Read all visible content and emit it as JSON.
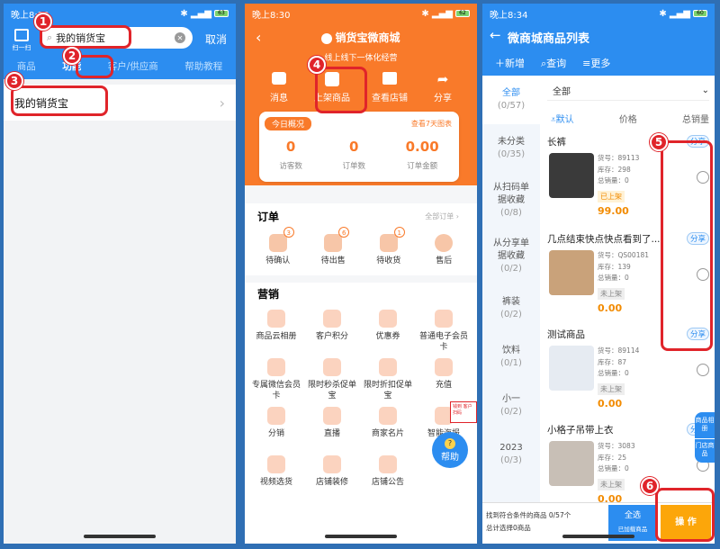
{
  "p1": {
    "status_time": "晚上8:30",
    "scan_label": "扫一扫",
    "search_value": "我的销货宝",
    "cancel": "取消",
    "tabs": [
      "商品",
      "功能",
      "客户/供应商",
      "帮助教程"
    ],
    "result": "我的销货宝",
    "markers": [
      "1",
      "2",
      "3"
    ]
  },
  "p2": {
    "status_time": "晚上8:30",
    "title": "销货宝微商城",
    "subtitle": "线上线下一体化经营",
    "top_actions": [
      "消息",
      "上架商品",
      "查看店铺",
      "分享"
    ],
    "overview_label": "今日概况",
    "overview_link": "查看7天图表",
    "stats": [
      {
        "value": "0",
        "label": "访客数"
      },
      {
        "value": "0",
        "label": "订单数"
      },
      {
        "value": "0.00",
        "label": "订单金额"
      }
    ],
    "orders_title": "订单",
    "orders_link": "全部订单",
    "orders": [
      {
        "label": "待确认",
        "count": "3"
      },
      {
        "label": "待出售",
        "count": "6"
      },
      {
        "label": "待收货",
        "count": "1"
      },
      {
        "label": "售后",
        "count": ""
      }
    ],
    "marketing_title": "营销",
    "marketing": [
      "商品云相册",
      "客户积分",
      "优惠券",
      "普通电子会员卡",
      "专属微信会员卡",
      "限时秒杀促单宝",
      "限时折扣促单宝",
      "充值",
      "分销",
      "直播",
      "商家名片",
      "智能海报",
      "视频选货",
      "店铺装修",
      "店铺公告"
    ],
    "help_button": "帮助",
    "marker": "4",
    "floating_tag": "钱到 客户扫码"
  },
  "p3": {
    "status_time": "晚上8:34",
    "title": "微商城商品列表",
    "actions": [
      "新增",
      "查询",
      "更多"
    ],
    "filter": "全部",
    "sort": [
      "默认",
      "价格",
      "总销量"
    ],
    "categories": [
      {
        "name": "全部",
        "count": "(0/57)"
      },
      {
        "name": "未分类",
        "count": "(0/35)"
      },
      {
        "name": "从扫码单据收藏",
        "count": "(0/8)"
      },
      {
        "name": "从分享单据收藏",
        "count": "(0/2)"
      },
      {
        "name": "裤装",
        "count": "(0/2)"
      },
      {
        "name": "饮料",
        "count": "(0/1)"
      },
      {
        "name": "小一",
        "count": "(0/2)"
      },
      {
        "name": "2023",
        "count": "(0/3)"
      }
    ],
    "products": [
      {
        "name": "长裤",
        "code": "货号：89113",
        "stock": "库存：298",
        "sales": "总销量：0",
        "status": "已上架",
        "price": "99.00"
      },
      {
        "name": "几点结束快点快点看到了...",
        "code": "货号：QS00181",
        "stock": "库存：139",
        "sales": "总销量：0",
        "status": "未上架",
        "price": "0.00"
      },
      {
        "name": "测试商品",
        "code": "货号：89114",
        "stock": "库存：87",
        "sales": "总销量：0",
        "status": "未上架",
        "price": "0.00"
      },
      {
        "name": "小格子吊带上衣",
        "code": "货号：3083",
        "stock": "库存：25",
        "sales": "总销量：0",
        "status": "未上架",
        "price": "0.00"
      }
    ],
    "share": "分享",
    "side_float": [
      "商品相册",
      "门店商品"
    ],
    "footer_found": "找到符合条件的商品 0/57个",
    "footer_selected": "总计选择0商品",
    "select_all": "全选",
    "select_all_sub": "已加载商品",
    "operate": "操 作",
    "markers": [
      "5",
      "6"
    ]
  }
}
